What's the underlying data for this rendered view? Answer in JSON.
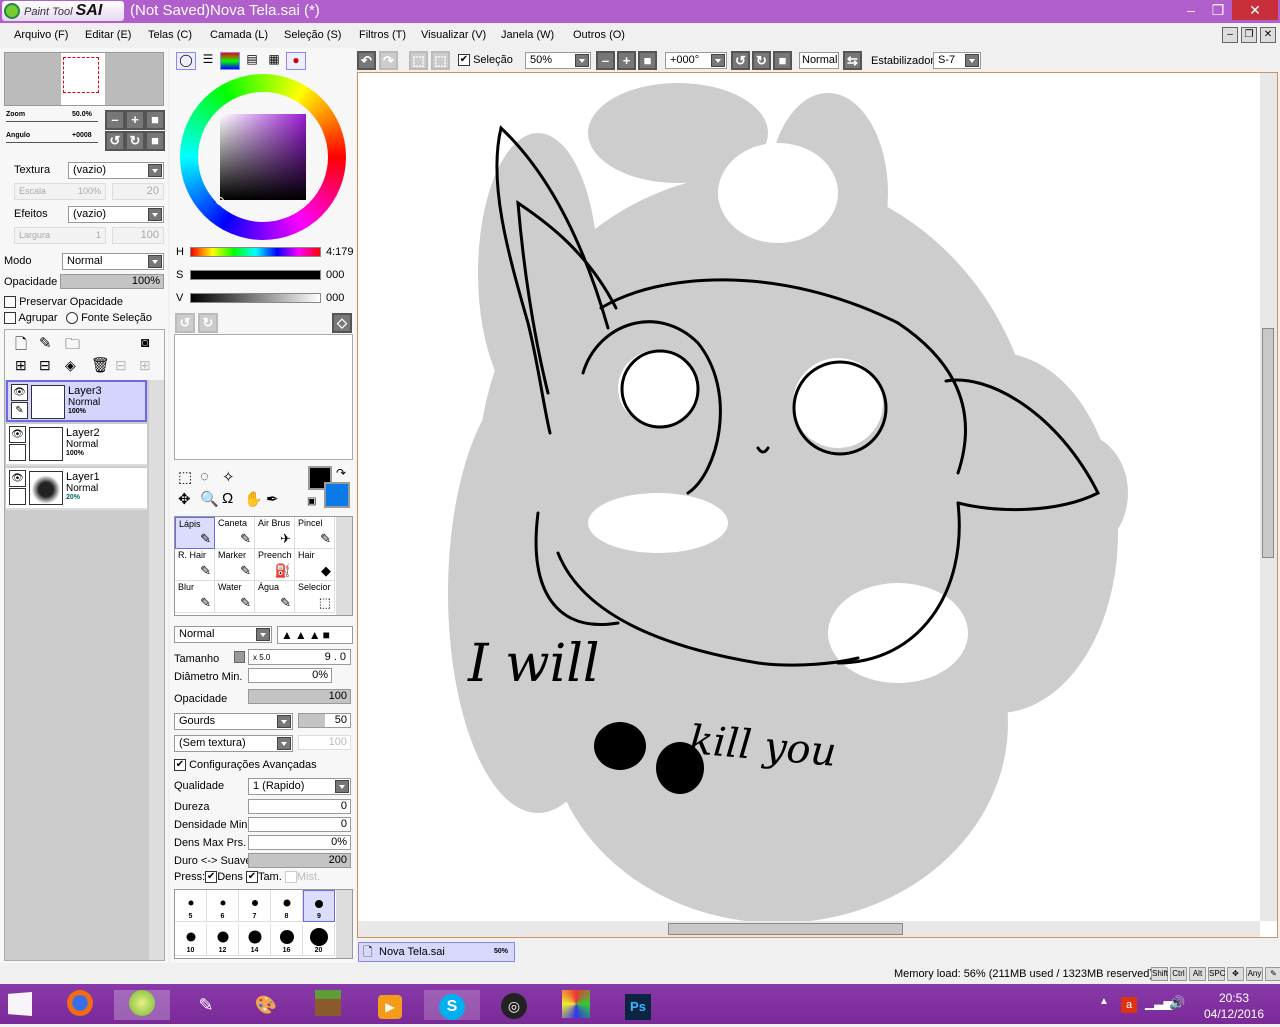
{
  "app": {
    "logo_text": "Paint Tool",
    "logo_brand": "SAI",
    "title": "(Not Saved)Nova Tela.sai (*)"
  },
  "window_controls": {
    "minimize": "–",
    "restore": "❐",
    "close": "✕"
  },
  "menu": [
    "Arquivo (F)",
    "Editar (E)",
    "Telas (C)",
    "Camada (L)",
    "Seleção (S)",
    "Filtros (T)",
    "Visualizar (V)",
    "Janela (W)",
    "Outros (O)"
  ],
  "navigator": {
    "zoom_label": "Zoom",
    "zoom_value": "50.0%",
    "angle_label": "Angulo",
    "angle_value": "+0008"
  },
  "layer_props": {
    "texture_label": "Textura",
    "texture_value": "(vazio)",
    "scale_label": "Escala",
    "scale_value": "100%",
    "scale_amount": "20",
    "effects_label": "Efeitos",
    "effects_value": "(vazio)",
    "width_label": "Largura",
    "width_value": "1",
    "width_amount": "100",
    "mode_label": "Modo",
    "mode_value": "Normal",
    "opacity_label": "Opacidade",
    "opacity_value": "100%",
    "preserve_opacity": "Preservar Opacidade",
    "group": "Agrupar",
    "selection_source": "Fonte Seleção"
  },
  "layers": [
    {
      "name": "Layer3",
      "mode": "Normal",
      "opacity": "100%",
      "selected": true
    },
    {
      "name": "Layer2",
      "mode": "Normal",
      "opacity": "100%",
      "selected": false
    },
    {
      "name": "Layer1",
      "mode": "Normal",
      "opacity": "20%",
      "selected": false
    }
  ],
  "color": {
    "h_label": "H",
    "h_value": "4:179",
    "s_label": "S",
    "s_value": "000",
    "v_label": "V",
    "v_value": "000",
    "primary": "#000000",
    "secondary": "#0a7ae8",
    "hue": 0.72
  },
  "tools": [
    "Lápis",
    "Caneta",
    "Air Brus",
    "Pincel",
    "R. Hair",
    "Marker",
    "Preench",
    "Hair",
    "Blur",
    "Water",
    "Água",
    "Selecior"
  ],
  "tool_icons": [
    "✎",
    "✎",
    "✈",
    "✎",
    "✎",
    "✎",
    "⛽",
    "◆",
    "✎",
    "✎",
    "✎",
    "⬚"
  ],
  "brush": {
    "mode": "Normal",
    "size_label": "Tamanho",
    "size_mult": "x 5.0",
    "size_value": "9 . 0",
    "min_diam_label": "Diâmetro Min.",
    "min_diam_value": "0%",
    "opacity_label": "Opacidade",
    "opacity_value": "100",
    "shape": "Gourds",
    "shape_value": "50",
    "texture": "(Sem textura)",
    "texture_value": "100",
    "advanced_label": "Configurações Avançadas",
    "quality_label": "Qualidade",
    "quality_value": "1 (Rapido)",
    "hardness_label": "Dureza",
    "hardness_value": "0",
    "min_density_label": "Densidade Min.",
    "min_density_value": "0",
    "max_dens_label": "Dens Max Prs.",
    "max_dens_value": "0%",
    "hard_soft_label": "Duro <-> Suave",
    "hard_soft_value": "200",
    "press_label": "Press:",
    "press_dens": "Dens",
    "press_size": "Tam.",
    "press_mix": "Mist."
  },
  "brush_sizes": [
    "5",
    "6",
    "7",
    "8",
    "9",
    "10",
    "12",
    "14",
    "16",
    "20"
  ],
  "toolbar": {
    "selection_label": "Seleção",
    "zoom_value": "50%",
    "angle_value": "+000°",
    "blend_value": "Normal",
    "stabilizer_label": "Estabilizador",
    "stabilizer_value": "S-7"
  },
  "canvas": {
    "drawn_text_1": "I will",
    "drawn_text_2": "kill you"
  },
  "doc_tab": {
    "name": "Nova Tela.sai",
    "zoom": "50%"
  },
  "status": {
    "memory": "Memory load: 56% (211MB used / 1323MB reserved)",
    "keys": [
      "Shift",
      "Ctrl",
      "Alt",
      "SPC",
      "✥",
      "Any",
      "✎"
    ]
  },
  "taskbar": {
    "time": "20:53",
    "date": "04/12/2016"
  }
}
